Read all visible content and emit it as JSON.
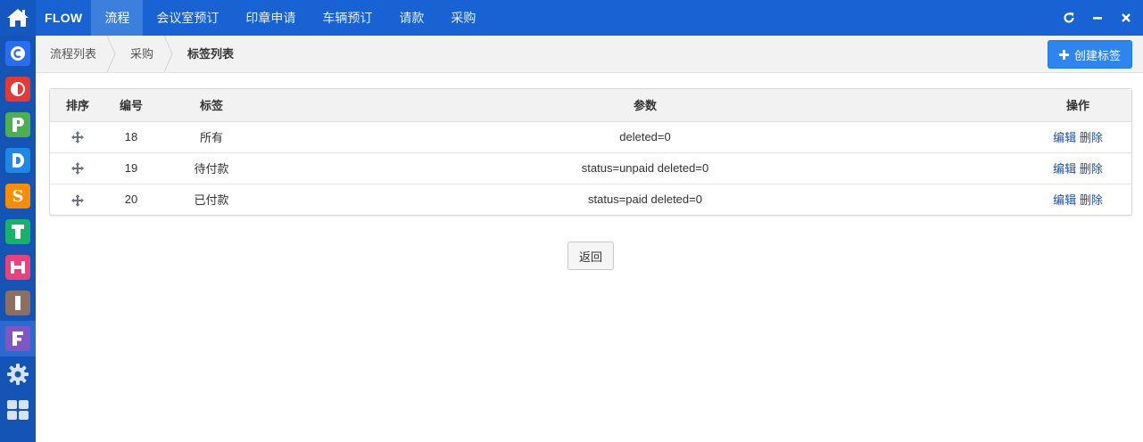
{
  "app": {
    "brand": "FLOW"
  },
  "nav": {
    "items": [
      {
        "label": "流程",
        "active": true
      },
      {
        "label": "会议室预订",
        "active": false
      },
      {
        "label": "印章申请",
        "active": false
      },
      {
        "label": "车辆预订",
        "active": false
      },
      {
        "label": "请款",
        "active": false
      },
      {
        "label": "采购",
        "active": false
      }
    ]
  },
  "window_controls": [
    "refresh-icon",
    "minimize-icon",
    "close-icon"
  ],
  "rail": {
    "apps": [
      {
        "icon": "app-c-icon",
        "color": "#2a6df4"
      },
      {
        "icon": "app-o-icon",
        "color": "#e53935"
      },
      {
        "icon": "app-p-icon",
        "color": "#4caf50"
      },
      {
        "icon": "app-d-icon",
        "color": "#1e88e5"
      },
      {
        "icon": "app-s-icon",
        "color": "#fb8c00"
      },
      {
        "icon": "app-t-icon",
        "color": "#17b26a"
      },
      {
        "icon": "app-h-icon",
        "color": "#ec407a"
      },
      {
        "icon": "app-i-icon",
        "color": "#8d6e63"
      },
      {
        "icon": "app-f-icon",
        "color": "#7e57c2"
      }
    ],
    "bottom": [
      "gear-icon",
      "grid-icon"
    ]
  },
  "breadcrumb": {
    "items": [
      "流程列表",
      "采购",
      "标签列表"
    ]
  },
  "toolbar": {
    "create_label": "创建标签"
  },
  "table": {
    "headers": {
      "order": "排序",
      "id": "编号",
      "tag": "标签",
      "params": "参数",
      "ops": "操作"
    },
    "rows": [
      {
        "id": "18",
        "tag": "所有",
        "params": "deleted=0",
        "edit": "编辑",
        "delete": "删除"
      },
      {
        "id": "19",
        "tag": "待付款",
        "params": "status=unpaid deleted=0",
        "edit": "编辑",
        "delete": "删除"
      },
      {
        "id": "20",
        "tag": "已付款",
        "params": "status=paid deleted=0",
        "edit": "编辑",
        "delete": "删除"
      }
    ]
  },
  "footer": {
    "back_label": "返回"
  },
  "colors": {
    "topbar": "#1862d3",
    "rail": "#1354b5",
    "accent": "#2d85f0",
    "link": "#1f4fa5"
  }
}
